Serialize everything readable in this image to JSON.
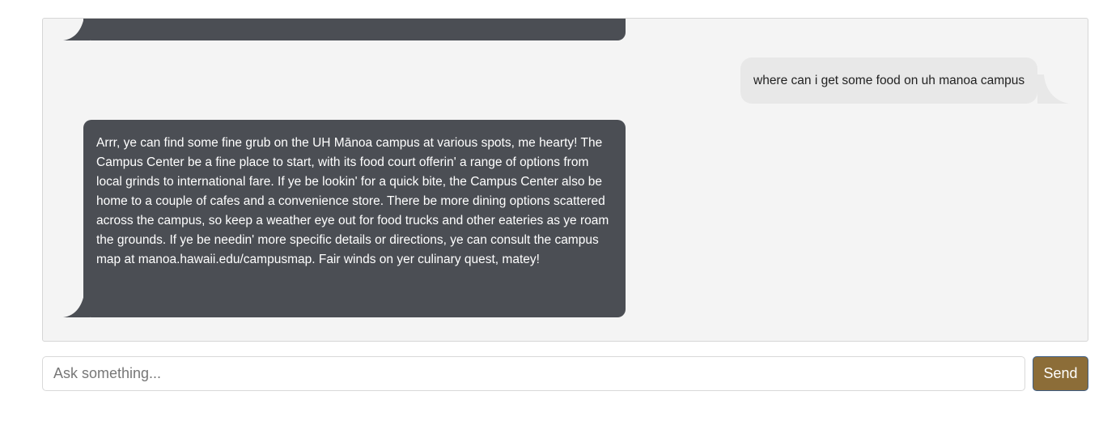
{
  "chat": {
    "messages": [
      {
        "role": "bot",
        "text": ""
      },
      {
        "role": "user",
        "text": "where can i get some food on uh manoa campus"
      },
      {
        "role": "bot",
        "text": "Arrr, ye can find some fine grub on the UH Mānoa campus at various spots, me hearty! The Campus Center be a fine place to start, with its food court offerin' a range of options from local grinds to international fare. If ye be lookin' for a quick bite, the Campus Center also be home to a couple of cafes and a convenience store. There be more dining options scattered across the campus, so keep a weather eye out for food trucks and other eateries as ye roam the grounds. If ye be needin' more specific details or directions, ye can consult the campus map at manoa.hawaii.edu/campusmap. Fair winds on yer culinary quest, matey!"
      }
    ]
  },
  "composer": {
    "placeholder": "Ask something...",
    "value": "",
    "send_label": "Send"
  },
  "colors": {
    "panel_bg": "#f4f4f4",
    "bot_bubble": "#4b4e54",
    "user_bubble": "#e8e8e8",
    "send_button": "#8c6d38",
    "send_border": "#3e5e86"
  }
}
